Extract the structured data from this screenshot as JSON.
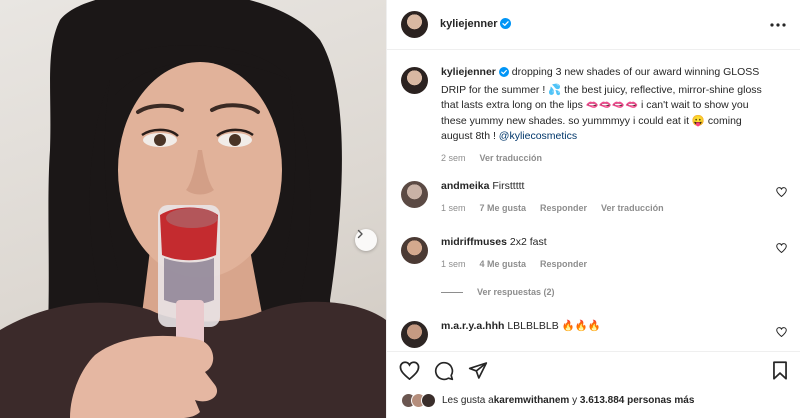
{
  "post": {
    "username": "kyliejenner",
    "caption_pre": "dropping 3 new shades of our award winning GLOSS DRIP for the summer ! 💦 the best juicy, reflective, mirror-shine gloss that lasts extra long on the lips 🫦🫦🫦🫦 i can't wait to show you these yummy new shades. so yummmyy i could eat it 😛 coming august 8th ! ",
    "caption_mention": "@kyliecosmetics",
    "time": "2 sem",
    "translate": "Ver traducción"
  },
  "comments": [
    {
      "username": "andmeika",
      "text": "Firsttttt",
      "time": "1 sem",
      "likes": "7 Me gusta",
      "reply": "Responder",
      "translate": "Ver traducción"
    },
    {
      "username": "midriffmuses",
      "text": "2x2 fast",
      "time": "1 sem",
      "likes": "4 Me gusta",
      "reply": "Responder"
    },
    {
      "username": "m.a.r.y.a.hhh",
      "text": "LBLBLBLB 🔥🔥🔥"
    }
  ],
  "view_replies": "Ver respuestas (2)",
  "likes": {
    "prefix": "Les gusta a ",
    "user": "karemwithanem",
    "middle": " y ",
    "count": "3.613.884 personas más"
  },
  "colors": {
    "verified": "#0095f6",
    "link": "#00376b",
    "muted": "#8e8e8e"
  },
  "icons": [
    "more-icon",
    "verified-icon",
    "heart-icon",
    "comment-icon",
    "share-icon",
    "bookmark-icon",
    "chevron-right-icon"
  ]
}
